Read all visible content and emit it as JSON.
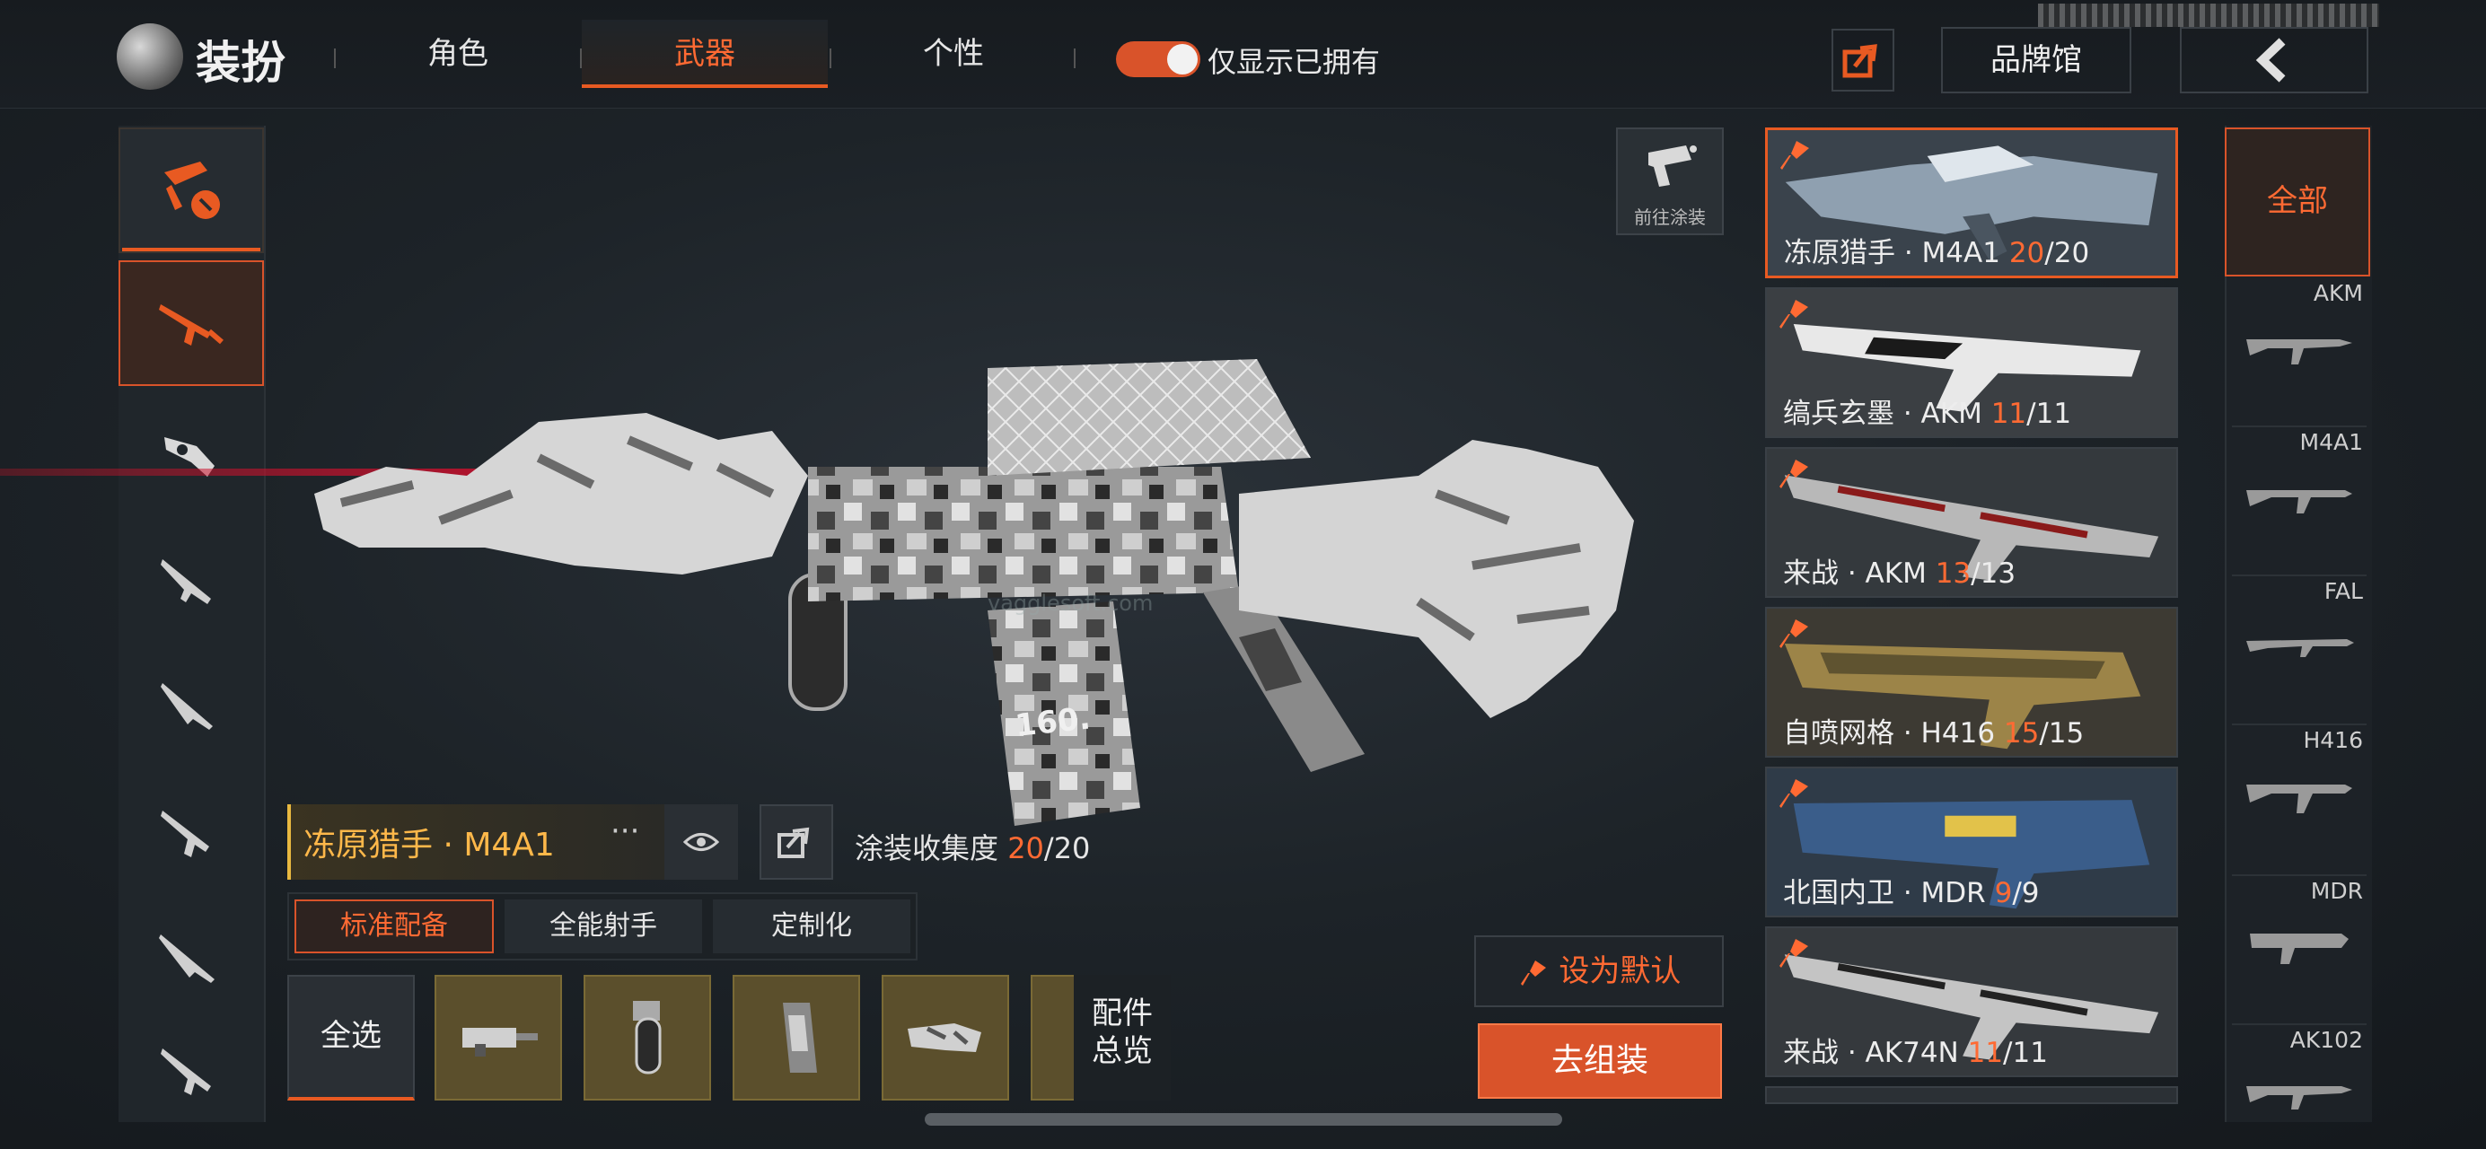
{
  "header": {
    "title": "装扮",
    "tabs": [
      {
        "label": "角色",
        "active": false
      },
      {
        "label": "武器",
        "active": true
      },
      {
        "label": "个性",
        "active": false
      }
    ],
    "toggle_label": "仅显示已拥有",
    "toggle_on": true,
    "brand_label": "品牌馆"
  },
  "viewer": {
    "paint_label": "前往涂装"
  },
  "weapon": {
    "name": "冻原猎手 · M4A1",
    "more": "···",
    "collect_label": "涂装收集度",
    "collect_current": "20",
    "collect_total": "/20"
  },
  "loadout_tabs": [
    "标准配备",
    "全能射手",
    "定制化"
  ],
  "attachments": {
    "select_all": "全选",
    "overview": "配件总览"
  },
  "actions": {
    "set_default": "设为默认",
    "assemble": "去组装"
  },
  "skins": [
    {
      "name": "冻原猎手 · M4A1",
      "owned": "20",
      "total": "/20"
    },
    {
      "name": "缟兵玄墨 · AKM",
      "owned": "11",
      "total": "/11"
    },
    {
      "name": "来战 · AKM",
      "owned": "13",
      "total": "/13"
    },
    {
      "name": "自喷网格 · H416",
      "owned": "15",
      "total": "/15"
    },
    {
      "name": "北国内卫 · MDR",
      "owned": "9",
      "total": "/9"
    },
    {
      "name": "来战 · AK74N",
      "owned": "11",
      "total": "/11"
    }
  ],
  "weapon_filter": {
    "all_label": "全部",
    "items": [
      "AKM",
      "M4A1",
      "FAL",
      "H416",
      "MDR",
      "AK102"
    ]
  },
  "colors": {
    "accent": "#e85a22",
    "accent_text": "#ff6a33",
    "gold": "#ffb84a"
  }
}
